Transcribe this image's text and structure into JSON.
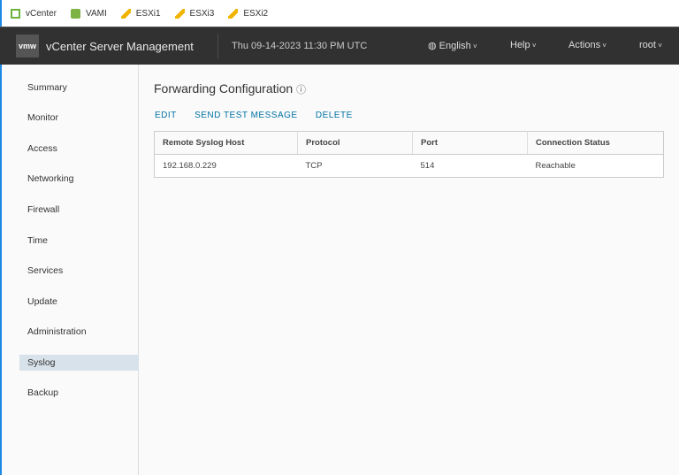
{
  "tabs": [
    {
      "label": "vCenter",
      "color": "#6cb33f"
    },
    {
      "label": "VAMI",
      "color": "#6cb33f"
    },
    {
      "label": "ESXi1",
      "color": "#f0b400"
    },
    {
      "label": "ESXi3",
      "color": "#f0b400"
    },
    {
      "label": "ESXi2",
      "color": "#f0b400"
    }
  ],
  "header": {
    "logo": "vmw",
    "title": "vCenter Server Management",
    "datetime": "Thu 09-14-2023 11:30 PM UTC",
    "language": "English",
    "help": "Help",
    "actions": "Actions",
    "user": "root"
  },
  "sidebar": [
    "Summary",
    "Monitor",
    "Access",
    "Networking",
    "Firewall",
    "Time",
    "Services",
    "Update",
    "Administration",
    "Syslog",
    "Backup"
  ],
  "main": {
    "title": "Forwarding Configuration",
    "actions": [
      "EDIT",
      "SEND TEST MESSAGE",
      "DELETE"
    ],
    "columns": [
      "Remote Syslog Host",
      "Protocol",
      "Port",
      "Connection Status"
    ],
    "rows": [
      [
        "192.168.0.229",
        "TCP",
        "514",
        "Reachable"
      ]
    ]
  }
}
